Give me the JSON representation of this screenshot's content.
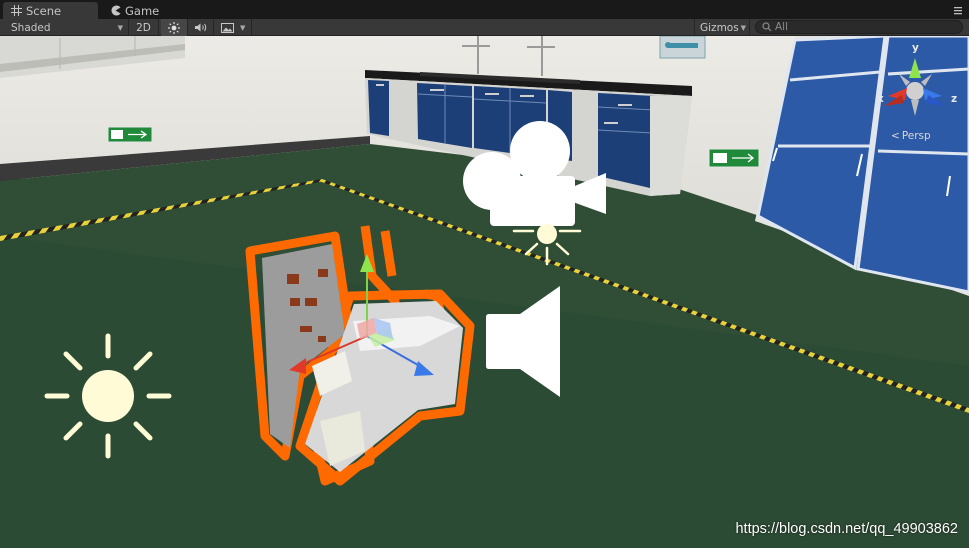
{
  "tabs": [
    {
      "label": "Scene",
      "icon": "grid-icon",
      "active": true
    },
    {
      "label": "Game",
      "icon": "pacman-icon",
      "active": false
    }
  ],
  "toolbar": {
    "shading_mode": "Shaded",
    "mode_2d": "2D",
    "gizmos_label": "Gizmos",
    "search_placeholder": "All"
  },
  "scene_gizmo": {
    "y_label": "y",
    "x_label": "x",
    "z_label": "z",
    "projection": "Persp"
  },
  "signs": {
    "exit_sign": "安全出口"
  },
  "watermark": "https://blog.csdn.net/qq_49903862",
  "colors": {
    "selection_outline": "#ff6a00",
    "floor": "#2f4e35",
    "light_icon": "#fffbd6",
    "cabinet": "#1c3f78"
  }
}
